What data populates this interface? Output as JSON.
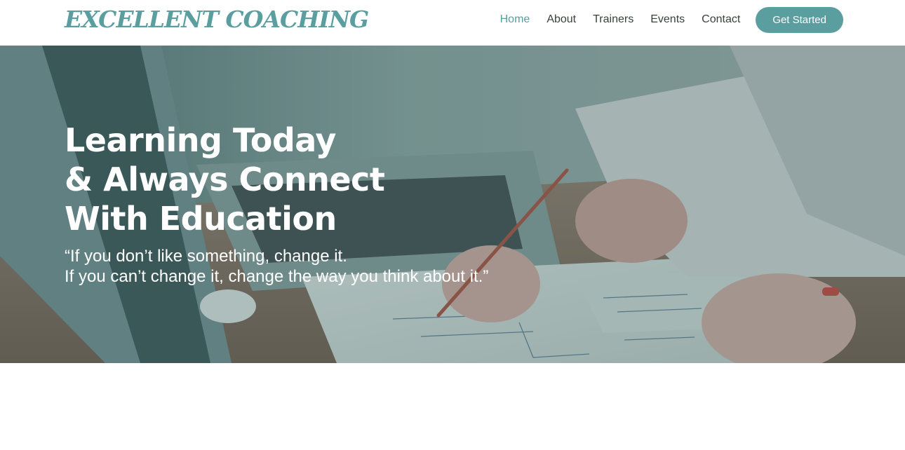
{
  "brand": {
    "logo_text": "EXCELLENT COACHING",
    "accent_color": "#5a9ea0"
  },
  "nav": {
    "items": [
      {
        "label": "Home",
        "active": true
      },
      {
        "label": "About",
        "active": false
      },
      {
        "label": "Trainers",
        "active": false
      },
      {
        "label": "Events",
        "active": false
      },
      {
        "label": "Contact",
        "active": false
      }
    ],
    "cta_label": "Get Started"
  },
  "hero": {
    "title_lines": [
      "Learning Today",
      "& Always Connect",
      "With Education"
    ],
    "quote_lines": [
      "“If you don’t like something, change it.",
      "If you can’t change it, change the way you think about it.”"
    ]
  }
}
